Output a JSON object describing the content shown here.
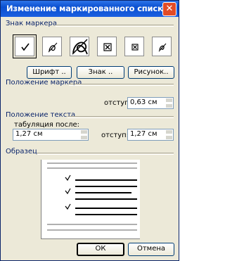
{
  "window": {
    "title": "Изменение маркированного списка",
    "close_label": "✕"
  },
  "bullet_section": {
    "label": "Знак маркера",
    "markers": [
      {
        "icon": "check-mark-icon",
        "selected": true
      },
      {
        "icon": "stylized-bullet-icon",
        "selected": false
      },
      {
        "icon": "large-script-bullet-icon",
        "selected": false
      },
      {
        "icon": "boxed-x-icon",
        "selected": false
      },
      {
        "icon": "boxed-x-small-icon",
        "selected": false
      },
      {
        "icon": "stylized-bullet-small-icon",
        "selected": false
      }
    ],
    "buttons": {
      "font": "Шрифт ..",
      "symbol": "Знак ..",
      "picture": "Рисунок.."
    }
  },
  "marker_position": {
    "label": "Положение маркера",
    "indent_label": "отступ:",
    "indent_value": "0,63 см"
  },
  "text_position": {
    "label": "Положение текста",
    "tab_label": "табуляция после:",
    "tab_value": "1,27 см",
    "indent_label": "отступ:",
    "indent_value": "1,27 см"
  },
  "sample": {
    "label": "Образец"
  },
  "footer": {
    "ok": "ОК",
    "cancel": "Отмена"
  }
}
